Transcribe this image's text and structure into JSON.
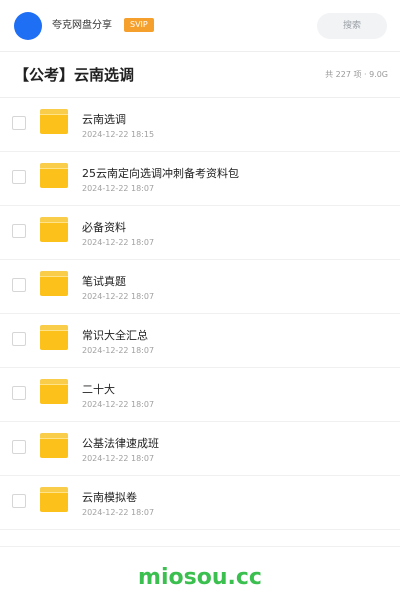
{
  "header": {
    "share_name": "夸克网盘分享",
    "badge": "SVIP",
    "search_label": "搜索"
  },
  "folder": {
    "title": "【公考】云南选调",
    "meta": "共 227 项 · 9.0G"
  },
  "files": [
    {
      "name": "云南选调",
      "date": "2024-12-22 18:15",
      "icon": "folder-icon"
    },
    {
      "name": "25云南定向选调冲刺备考资料包",
      "date": "2024-12-22 18:07",
      "icon": "folder-icon"
    },
    {
      "name": "必备资料",
      "date": "2024-12-22 18:07",
      "icon": "folder-icon"
    },
    {
      "name": "笔试真题",
      "date": "2024-12-22 18:07",
      "icon": "folder-icon"
    },
    {
      "name": "常识大全汇总",
      "date": "2024-12-22 18:07",
      "icon": "folder-icon"
    },
    {
      "name": "二十大",
      "date": "2024-12-22 18:07",
      "icon": "folder-icon"
    },
    {
      "name": "公基法律速成班",
      "date": "2024-12-22 18:07",
      "icon": "folder-icon"
    },
    {
      "name": "云南模拟卷",
      "date": "2024-12-22 18:07",
      "icon": "folder-icon"
    }
  ],
  "watermark": "miosou.cc",
  "colors": {
    "avatar": "#1f6ff5",
    "badge": "#f5a02c",
    "folder": "#fcc21b",
    "watermark": "#3bbf4f"
  }
}
